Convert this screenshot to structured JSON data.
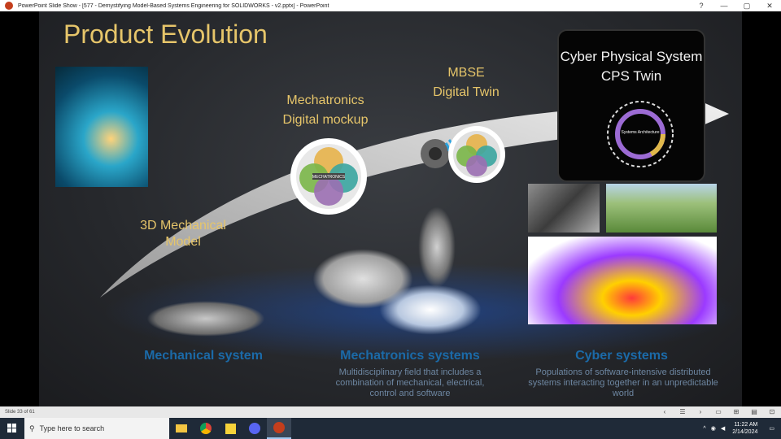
{
  "window": {
    "title": "PowerPoint Slide Show - [577 - Demystifying Model-Based Systems Engineering for SOLIDWORKS - v2.pptx] - PowerPoint"
  },
  "slide": {
    "title": "Product Evolution",
    "stages": {
      "mechanical": "3D Mechanical Model",
      "mechatronics_line1": "Mechatronics",
      "mechatronics_line2": "Digital mockup",
      "mbse_line1": "MBSE",
      "mbse_line2": "Digital Twin",
      "cps_line1": "Cyber Physical System",
      "cps_line2": "CPS Twin"
    },
    "systems": [
      {
        "title": "Mechanical system",
        "desc": ""
      },
      {
        "title": "Mechatronics systems",
        "desc": "Multidisciplinary field that includes a combination of mechanical, electrical, control and software"
      },
      {
        "title": "Cyber systems",
        "desc": "Populations of software-intensive distributed systems interacting together in an unpredictable world"
      }
    ],
    "diagram_center": "MECHATRONICS",
    "cps_center": "Systems Architecture"
  },
  "statusbar": {
    "slide_number": "Slide 33 of 61"
  },
  "taskbar": {
    "search_placeholder": "Type here to search",
    "time": "11:22 AM",
    "date": "2/14/2024"
  },
  "colors": {
    "title_gold": "#e6c56a",
    "system_blue": "#1b6aa8",
    "taskbar": "#1f2a38"
  }
}
